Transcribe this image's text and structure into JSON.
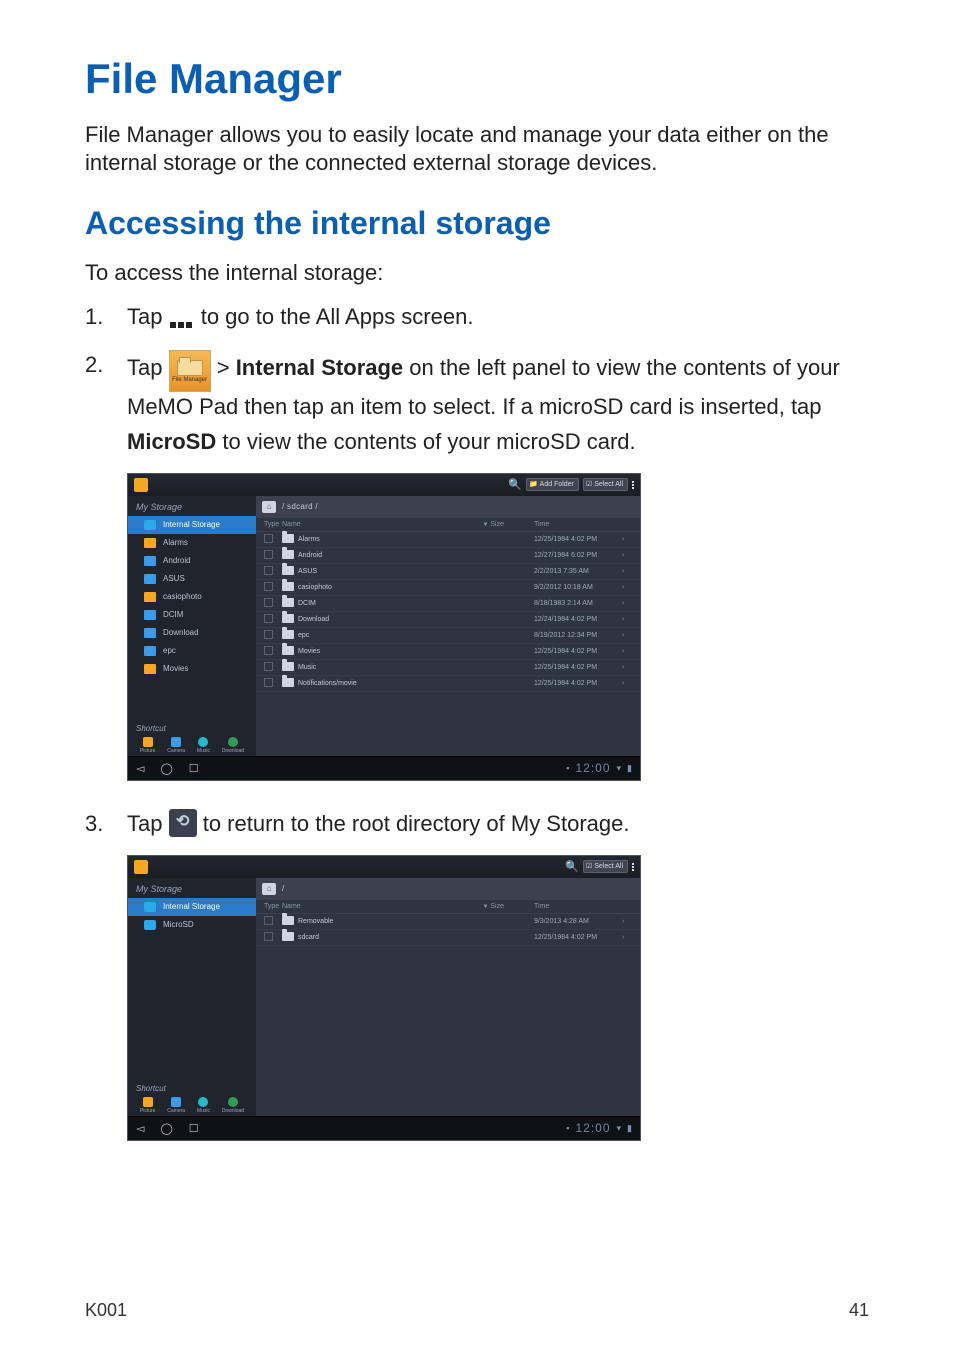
{
  "page": {
    "title": "File Manager",
    "intro": "File Manager allows you to easily locate and manage your data either on the internal storage or the connected external storage devices.",
    "section": "Accessing the internal storage",
    "lead": "To access the internal storage:",
    "steps": {
      "s1_num": "1.",
      "s1_a": "Tap ",
      "s1_b": " to go to the All Apps screen.",
      "s2_num": "2.",
      "s2_a": "Tap ",
      "s2_b": " > ",
      "s2_strong": "Internal Storage",
      "s2_c": " on the left panel to view the contents of your MeMO Pad then tap an item to select. If a microSD card is inserted, tap ",
      "s2_strong2": "MicroSD",
      "s2_d": " to view the contents of your microSD card.",
      "s3_num": "3.",
      "s3_a": "Tap ",
      "s3_b": " to return to the root directory of My Storage."
    },
    "fm_caption": "File Manager",
    "footer_model": "K001",
    "footer_page": "41"
  },
  "ss1": {
    "toolbar": {
      "add_label": "Add Folder",
      "select_label": "Select All"
    },
    "side_title": "My Storage",
    "side_items": [
      {
        "label": "Internal Storage",
        "icon": "chip",
        "selected": true
      },
      {
        "label": "Alarms",
        "icon": "folder-o"
      },
      {
        "label": "Android",
        "icon": "folder-b"
      },
      {
        "label": "ASUS",
        "icon": "folder-b"
      },
      {
        "label": "casiophoto",
        "icon": "folder-o"
      },
      {
        "label": "DCIM",
        "icon": "folder-b"
      },
      {
        "label": "Download",
        "icon": "folder-b"
      },
      {
        "label": "epc",
        "icon": "folder-b"
      },
      {
        "label": "Movies",
        "icon": "folder-o"
      }
    ],
    "shortcut_label": "Shortcut",
    "shortcuts": [
      {
        "label": "Picture",
        "cls": "o"
      },
      {
        "label": "Camera",
        "cls": ""
      },
      {
        "label": "Music",
        "cls": "c"
      },
      {
        "label": "Download",
        "cls": "g"
      }
    ],
    "breadcrumb": "/ sdcard /",
    "cols": {
      "type": "Type",
      "name": "Name",
      "size": "Size",
      "time": "Time"
    },
    "rows": [
      {
        "name": "Alarms",
        "time": "12/25/1984 4:02 PM"
      },
      {
        "name": "Android",
        "time": "12/27/1984 6:02 PM"
      },
      {
        "name": "ASUS",
        "time": "2/2/2013 7:35 AM"
      },
      {
        "name": "casiophoto",
        "time": "9/2/2012 10:18 AM"
      },
      {
        "name": "DCIM",
        "time": "8/18/1983 2:14 AM"
      },
      {
        "name": "Download",
        "time": "12/24/1984 4:02 PM"
      },
      {
        "name": "epc",
        "time": "8/19/2012 12:34 PM"
      },
      {
        "name": "Movies",
        "time": "12/25/1984 4:02 PM"
      },
      {
        "name": "Music",
        "time": "12/25/1984 4:02 PM"
      },
      {
        "name": "Notifications/movie",
        "time": "12/25/1984 4:02 PM"
      }
    ],
    "clock": "12:00"
  },
  "ss2": {
    "toolbar": {
      "select_label": "Select All"
    },
    "side_title": "My Storage",
    "side_items": [
      {
        "label": "Internal Storage",
        "icon": "chip",
        "selected": true
      },
      {
        "label": "MicroSD",
        "icon": "chip",
        "selected": false
      }
    ],
    "shortcut_label": "Shortcut",
    "shortcuts": [
      {
        "label": "Picture",
        "cls": "o"
      },
      {
        "label": "Camera",
        "cls": ""
      },
      {
        "label": "Music",
        "cls": "c"
      },
      {
        "label": "Download",
        "cls": "g"
      }
    ],
    "breadcrumb": "/",
    "cols": {
      "type": "Type",
      "name": "Name",
      "size": "Size",
      "time": "Time"
    },
    "rows": [
      {
        "name": "Removable",
        "time": "9/3/2013 4:28 AM"
      },
      {
        "name": "sdcard",
        "time": "12/25/1984 4:02 PM"
      }
    ],
    "clock": "12:00"
  }
}
